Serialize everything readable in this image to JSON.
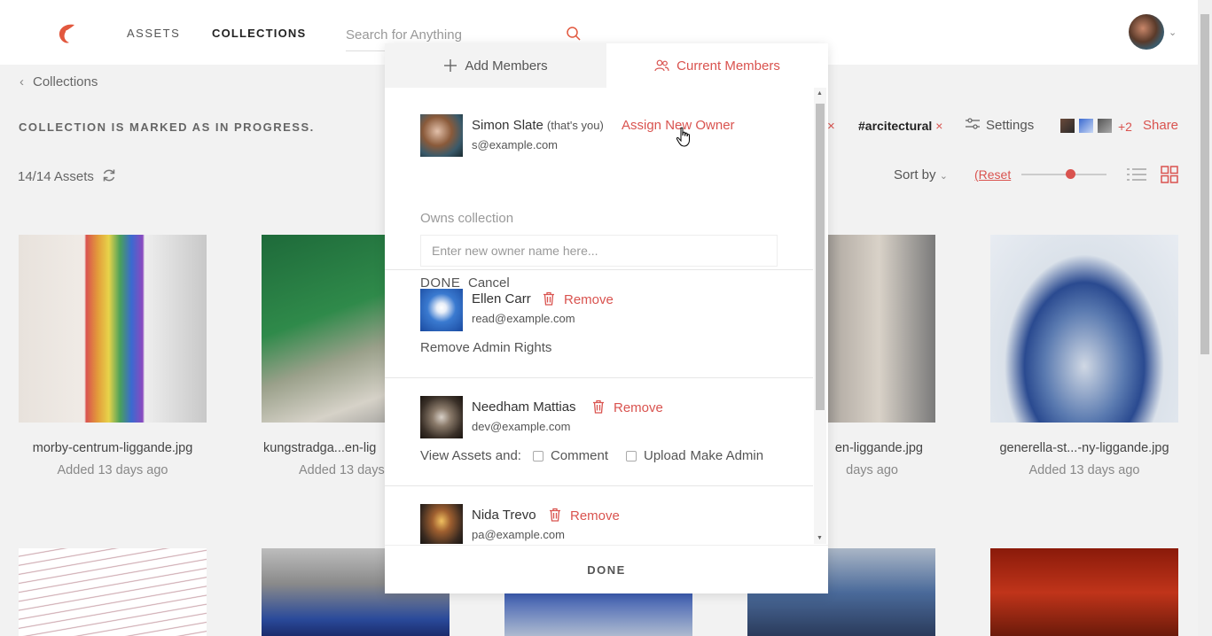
{
  "header": {
    "nav": {
      "assets": "ASSETS",
      "collections": "COLLECTIONS"
    },
    "search_placeholder": "Search for Anything"
  },
  "page": {
    "breadcrumb": "Collections",
    "banner": "COLLECTION IS MARKED AS IN PROGRESS.",
    "tag": "#arcitectural",
    "settings_label": "Settings",
    "extra_count": "+2",
    "share_label": "Share",
    "asset_count": "14/14 Assets",
    "sort_label": "Sort by",
    "reset_label": "(Reset",
    "cards": [
      {
        "name": "morby-centrum-liggande.jpg",
        "added": "Added 13 days ago"
      },
      {
        "name": "kungstradga...en-lig",
        "added": "Added 13 days"
      },
      {
        "name": "en-liggande.jpg",
        "added": "days ago"
      },
      {
        "name": "generella-st...-ny-liggande.jpg",
        "added": "Added 13 days ago"
      }
    ]
  },
  "modal": {
    "tabs": {
      "add": "Add Members",
      "current": "Current Members"
    },
    "members": [
      {
        "name": "Simon Slate",
        "you": "(that's you)",
        "email": "s@example.com",
        "action": "Assign New Owner",
        "owns": "Owns collection",
        "owner_placeholder": "Enter new owner name here...",
        "done": "DONE",
        "cancel": "Cancel"
      },
      {
        "name": "Ellen Carr",
        "email": "read@example.com",
        "action": "Remove",
        "extra": "Remove Admin Rights"
      },
      {
        "name": "Needham Mattias",
        "email": "dev@example.com",
        "action": "Remove",
        "view_label": "View Assets and:",
        "comment_label": "Comment",
        "upload_label": "Upload",
        "make_admin_label": "Make Admin"
      },
      {
        "name": "Nida Trevo",
        "email": "pa@example.com",
        "action": "Remove"
      }
    ],
    "footer_done": "DONE"
  },
  "colors": {
    "accent": "#d9534f"
  }
}
